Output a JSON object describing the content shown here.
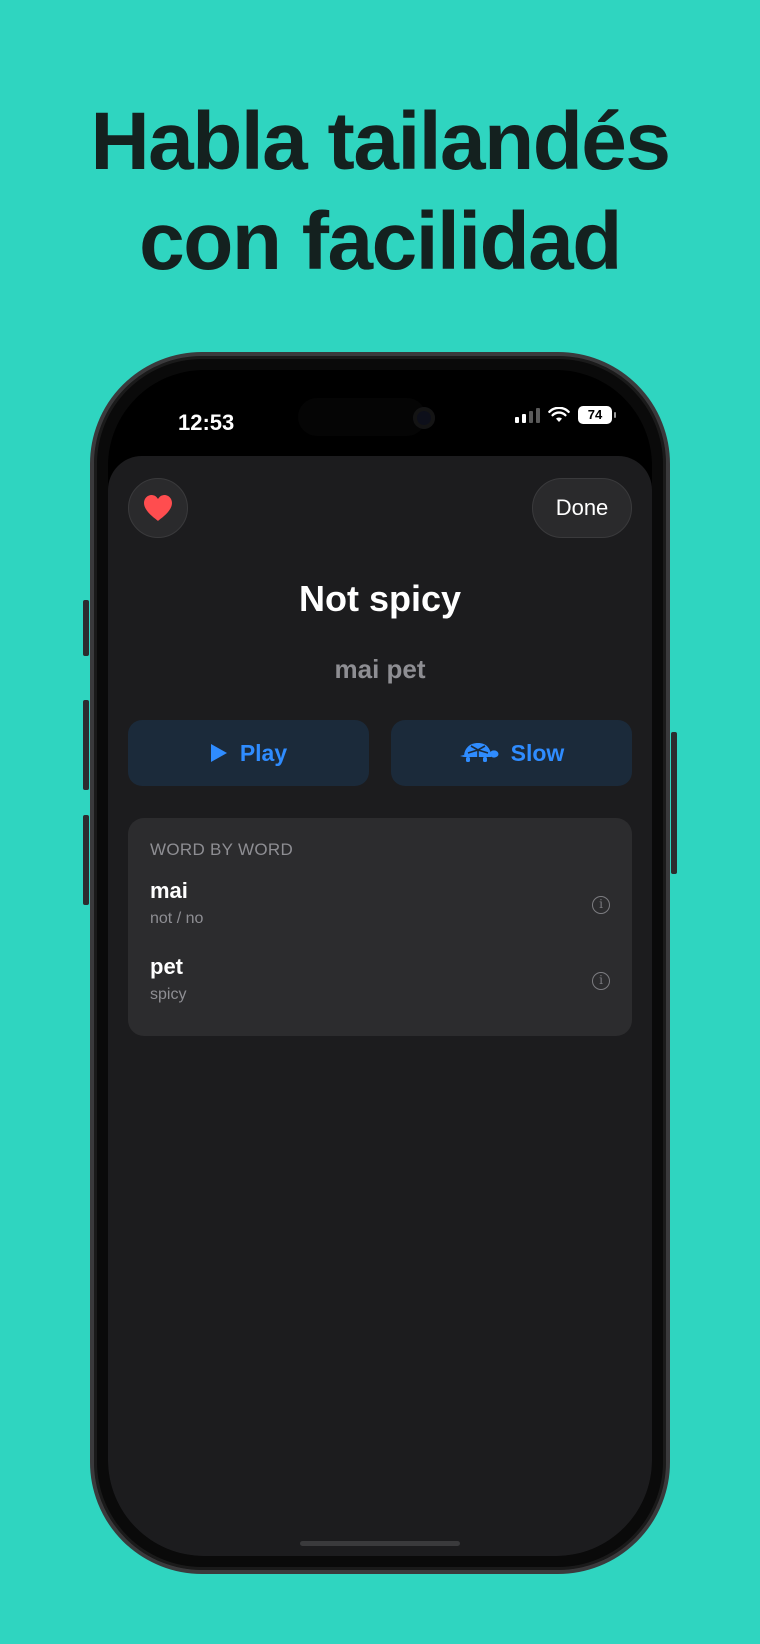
{
  "headline": {
    "line1": "Habla tailandés",
    "line2": "con facilidad"
  },
  "status_bar": {
    "time": "12:53",
    "battery": "74",
    "icons": [
      "signal-icon",
      "wifi-icon",
      "battery-icon"
    ]
  },
  "sheet": {
    "favorite_icon": "heart-icon",
    "done_label": "Done",
    "title": "Not spicy",
    "transliteration": "mai pet",
    "play": {
      "icon": "play-icon",
      "label": "Play"
    },
    "slow": {
      "icon": "turtle-icon",
      "label": "Slow"
    },
    "word_by_word": {
      "header": "WORD BY WORD",
      "words": [
        {
          "word": "mai",
          "meaning": "not / no",
          "icon": "info-icon"
        },
        {
          "word": "pet",
          "meaning": "spicy",
          "icon": "info-icon"
        }
      ]
    }
  },
  "colors": {
    "background": "#2fd5c0",
    "headline": "#14211f",
    "sheet": "#1c1c1e",
    "card": "#2c2c2e",
    "accent_blue": "#2f8cff",
    "heart_red": "#ff4d4f",
    "secondary_text": "#8e8e93"
  }
}
